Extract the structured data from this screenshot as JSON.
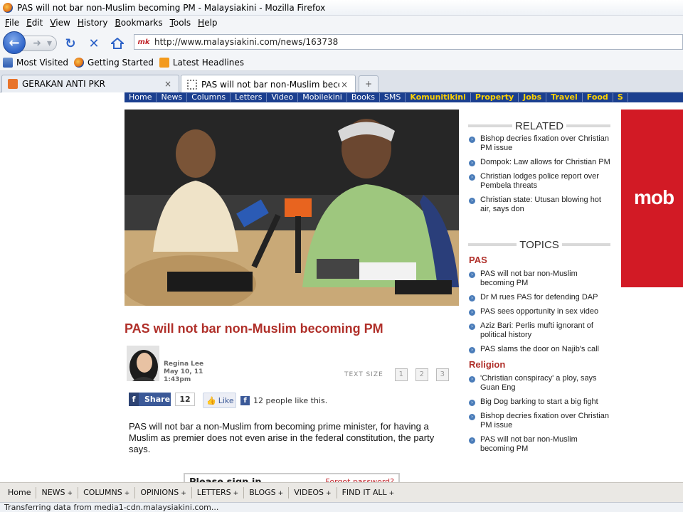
{
  "window": {
    "title": "PAS will not bar non-Muslim becoming PM - Malaysiakini - Mozilla Firefox"
  },
  "menu": [
    "File",
    "Edit",
    "View",
    "History",
    "Bookmarks",
    "Tools",
    "Help"
  ],
  "navigation": {
    "url": "http://www.malaysiakini.com/news/163738",
    "site_icon_text": "mk"
  },
  "bookmarks": [
    "Most Visited",
    "Getting Started",
    "Latest Headlines"
  ],
  "tabs": [
    {
      "title": "GERAKAN ANTI PKR",
      "close": "×"
    },
    {
      "title": "PAS will not bar non-Muslim beco...",
      "close": "×"
    }
  ],
  "new_tab_label": "+",
  "site_nav": [
    "Home",
    "News",
    "Columns",
    "Letters",
    "Video",
    "Mobilekini",
    "Books",
    "SMS"
  ],
  "site_nav_highlight": [
    "Komunitikini",
    "Property",
    "Jobs",
    "Travel",
    "Food",
    "S"
  ],
  "article": {
    "headline": "PAS will not bar non-Muslim becoming PM",
    "author": "Regina Lee",
    "date": "May 10, 11",
    "time": "1:43pm",
    "text_size_label": "TEXT SIZE",
    "text_size_options": [
      "1",
      "2",
      "3"
    ],
    "share_label": "Share",
    "share_count": "12",
    "like_label": "Like",
    "like_text": "12 people like this.",
    "lead": "PAS will not bar a non-Muslim from becoming prime minister, for having a Muslim as premier does not even arise in the federal constitution, the party says.",
    "signin_title": "Please sign in",
    "signin_forgot": "Forgot password?"
  },
  "related": {
    "heading": "RELATED",
    "items": [
      "Bishop decries fixation over Christian PM issue",
      "Dompok: Law allows for Christian PM",
      "Christian lodges police report over Pembela threats",
      "Christian state: Utusan blowing hot air, says don"
    ]
  },
  "topics": {
    "heading": "TOPICS",
    "categories": [
      {
        "name": "PAS",
        "items": [
          "PAS will not bar non-Muslim becoming PM",
          "Dr M rues PAS for defending DAP",
          "PAS sees opportunity in sex video",
          "Aziz Bari: Perlis mufti ignorant of political history",
          "PAS slams the door on Najib's call"
        ]
      },
      {
        "name": "Religion",
        "items": [
          "'Christian conspiracy' a ploy, says Guan Eng",
          "Big Dog barking to start a big fight",
          "Bishop decries fixation over Christian PM issue",
          "PAS will not bar non-Muslim becoming PM"
        ]
      }
    ]
  },
  "ad": {
    "text": "mob"
  },
  "bottom_nav": [
    {
      "label": "Home",
      "plus": ""
    },
    {
      "label": "NEWS",
      "plus": "+"
    },
    {
      "label": "COLUMNS",
      "plus": "+"
    },
    {
      "label": "OPINIONS",
      "plus": "+"
    },
    {
      "label": "LETTERS",
      "plus": "+"
    },
    {
      "label": "BLOGS",
      "plus": "+"
    },
    {
      "label": "VIDEOS",
      "plus": "+"
    },
    {
      "label": "FIND IT ALL",
      "plus": "+"
    }
  ],
  "status": "Transferring data from media1-cdn.malaysiakini.com...",
  "colors": {
    "headline": "#b0302a",
    "site_nav_bg": "#1b3f8f",
    "ad_bg": "#d21a25",
    "link_bullet": "#4a7cb9"
  }
}
